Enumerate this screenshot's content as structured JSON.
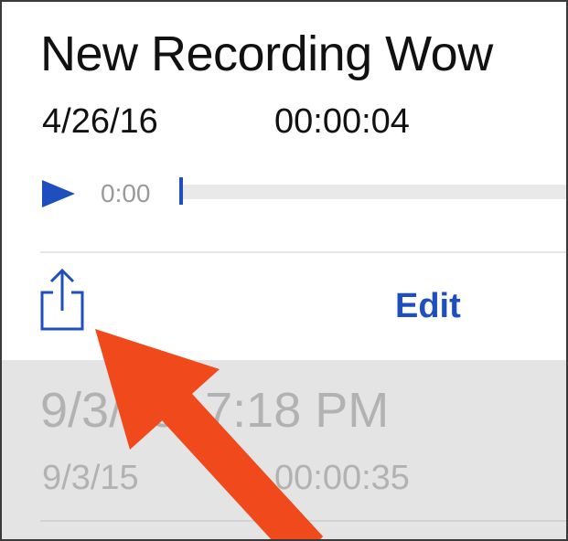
{
  "recording": {
    "title": "New Recording Wow",
    "date": "4/26/16",
    "duration": "00:00:04",
    "current_time": "0:00",
    "progress": 0
  },
  "actions": {
    "share_icon": "share-icon",
    "edit_label": "Edit"
  },
  "list": {
    "items": [
      {
        "title": "9/3/15, 7:18 PM",
        "date": "9/3/15",
        "duration": "00:00:35"
      }
    ]
  },
  "colors": {
    "accent": "#1f4fbf",
    "annotation": "#f04a1c",
    "muted_text": "#b2b2b2",
    "list_background": "#e4e4e4"
  }
}
